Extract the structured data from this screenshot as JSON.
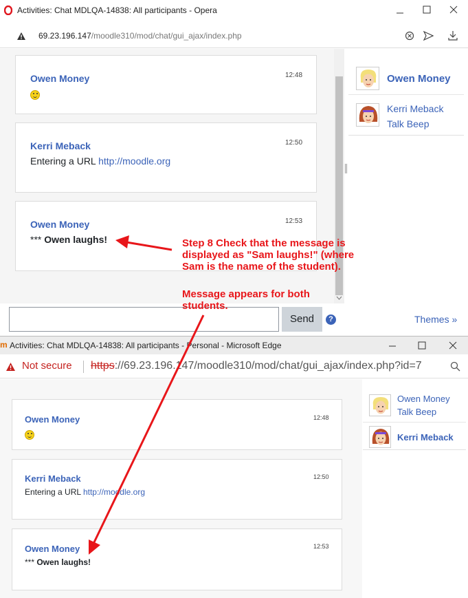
{
  "opera": {
    "window_title": "Activities: Chat MDLQA-14838: All participants - Opera",
    "url_host": "69.23.196.147",
    "url_path": "/moodle310/mod/chat/gui_ajax/index.php",
    "messages": [
      {
        "user": "Owen Money",
        "time": "12:48",
        "text": "",
        "emoji": "smiley"
      },
      {
        "user": "Kerri Meback",
        "time": "12:50",
        "text": "Entering a URL ",
        "link": "http://moodle.org"
      },
      {
        "user": "Owen Money",
        "time": "12:53",
        "prefix": "*** ",
        "emote": "Owen laughs!"
      }
    ],
    "participants": [
      {
        "name": "Owen Money",
        "status": "",
        "bold": true
      },
      {
        "name": "Kerri Meback",
        "status": "Talk Beep",
        "bold": false
      }
    ],
    "send_label": "Send",
    "help": "?",
    "themes_label": "Themes »"
  },
  "edge": {
    "window_title": "Activities: Chat MDLQA-14838: All participants - Personal - Microsoft Edge",
    "not_secure": "Not secure",
    "url_scheme": "https",
    "url_rest": "://69.23.196.147/moodle310/mod/chat/gui_ajax/index.php?id=7",
    "messages": [
      {
        "user": "Owen Money",
        "time": "12:48",
        "text": "",
        "emoji": "smiley"
      },
      {
        "user": "Kerri Meback",
        "time": "12:50",
        "text": "Entering a URL ",
        "link": "http://moodle.org"
      },
      {
        "user": "Owen Money",
        "time": "12:53",
        "prefix": "*** ",
        "emote": "Owen laughs!"
      }
    ],
    "participants": [
      {
        "name": "Owen Money",
        "status": "Talk Beep",
        "bold": false
      },
      {
        "name": "Kerri Meback",
        "status": "",
        "bold": true
      }
    ]
  },
  "annotation": {
    "step_lines": [
      "Step 8 Check that the message is",
      "displayed as \"Sam laughs!\" (where",
      "Sam is the name of the student)."
    ],
    "result_lines": [
      "Message appears for both",
      "students."
    ],
    "color": "#e8161a"
  }
}
